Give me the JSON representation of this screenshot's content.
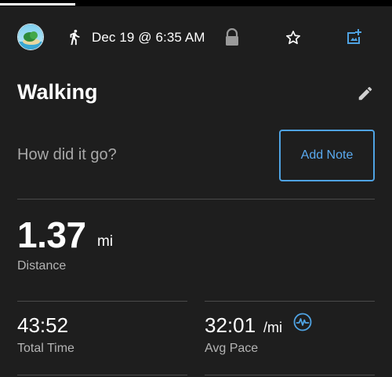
{
  "header": {
    "date": "Dec 19 @ 6:35 AM",
    "icons": [
      "avatar",
      "walking-icon",
      "lock-icon",
      "star-icon",
      "add-photo-icon"
    ]
  },
  "activity": {
    "title": "Walking",
    "edit_icon": "pencil-icon"
  },
  "note": {
    "prompt": "How did it go?",
    "button_label": "Add Note"
  },
  "distance": {
    "value": "1.37",
    "unit": "mi",
    "label": "Distance"
  },
  "total_time": {
    "value": "43:52",
    "label": "Total Time"
  },
  "avg_pace": {
    "value": "32:01",
    "unit": "/mi",
    "label": "Avg Pace",
    "icon": "pace-graph-icon"
  },
  "colors": {
    "background": "#1e1e1e",
    "accent": "#4fa3e3",
    "text": "#ffffff",
    "secondary_text": "#b4b4b4"
  }
}
